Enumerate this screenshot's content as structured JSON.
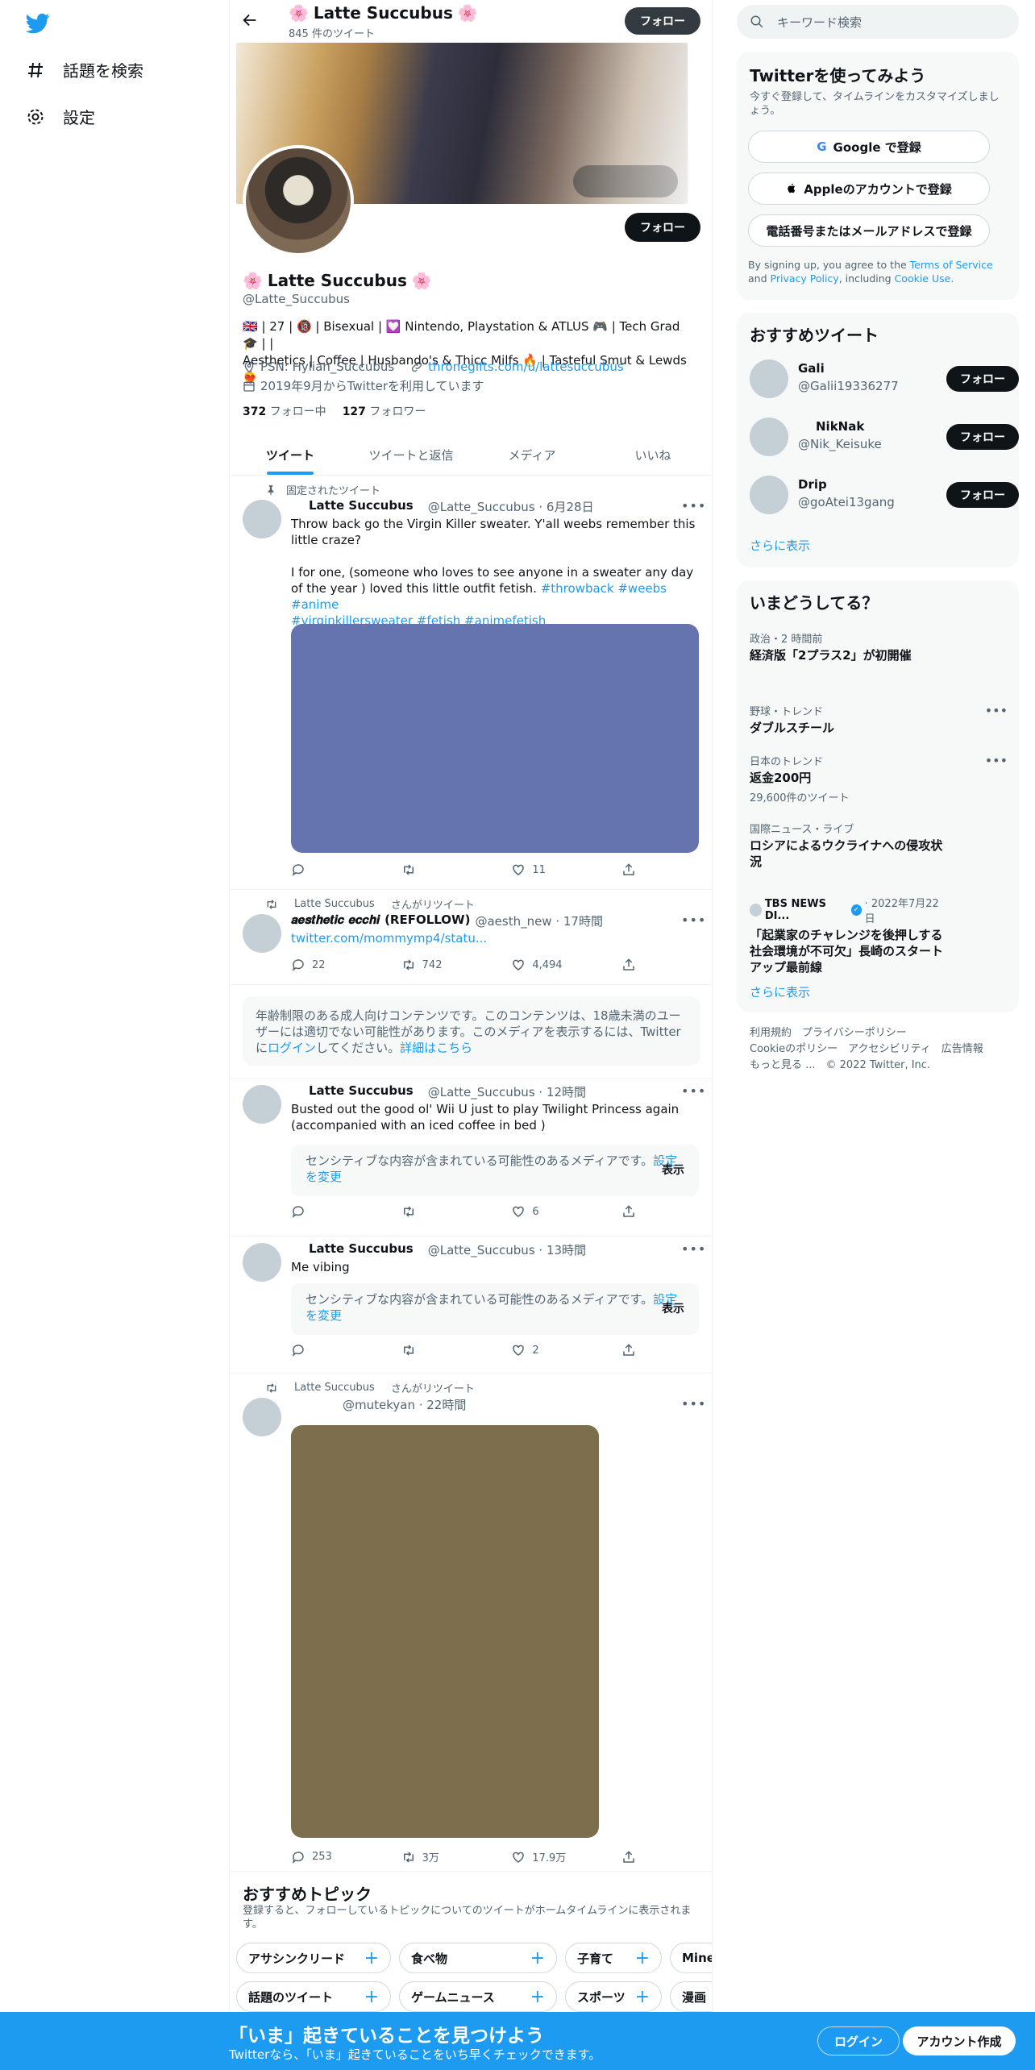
{
  "nav": {
    "explore_label": "話題を検索",
    "settings_label": "設定"
  },
  "header": {
    "title": "Latte Succubus",
    "tweet_count": "845 件のツイート",
    "follow_label": "フォロー"
  },
  "profile": {
    "name": "Latte Succubus",
    "handle": "@Latte_Succubus",
    "bio_line1": "🇬🇧 | 27 | 🔞 | Bisexual | 💟 Nintendo, Playstation & ATLUS 🎮 | Tech Grad 🎓 | |",
    "bio_line2": "Aesthetics | Coffee | Husbando's & Thicc Milfs 🔥 | Tasteful Smut & Lewds ❤️‍🔥",
    "location": "PSN: Hylian_Succubus",
    "link": "thronegifts.com/u/lattesuccubus",
    "joined": "2019年9月からTwitterを利用しています",
    "following_count": "372",
    "following_label": "フォロー中",
    "followers_count": "127",
    "followers_label": "フォロワー",
    "follow_label": "フォロー"
  },
  "tabs": [
    "ツイート",
    "ツイートと返信",
    "メディア",
    "いいね"
  ],
  "tweets": [
    {
      "context": "固定されたツイート",
      "name": "Latte Succubus",
      "meta": "@Latte_Succubus · 6月28日",
      "text1": "Throw back go the Virgin Killer sweater. Y'all weebs remember this little craze?",
      "text2": "I for one, (someone who loves to see anyone in a sweater any day of the year      ) loved this little outfit fetish.",
      "tags1": "#throwback #weebs #anime",
      "tags2": "#virginkillersweater #fetish #animefetish",
      "likes": "11"
    },
    {
      "context_name": "Latte Succubus",
      "context": "さんがリツイート",
      "name": "𝒂𝒆𝒔𝒕𝒉𝒆𝒕𝒊𝒄 𝒆𝒄𝒄𝒉𝒊",
      "name_suffix": "(REFOLLOW)",
      "meta": "@aesth_new · 17時間",
      "link": "twitter.com/mommymp4/statu...",
      "replies": "22",
      "retweets": "742",
      "likes": "4,494"
    },
    {
      "name": "Latte Succubus",
      "meta": "@Latte_Succubus · 12時間",
      "text1": "Busted out the good ol' Wii U just to play Twilight Princess again",
      "text2": "(accompanied with an iced coffee in bed           )",
      "likes": "6"
    },
    {
      "name": "Latte Succubus",
      "meta": "@Latte_Succubus · 13時間",
      "text1": "Me vibing",
      "likes": "2"
    },
    {
      "context_name": "Latte Succubus",
      "context": "さんがリツイート",
      "meta": "@mutekyan · 22時間",
      "replies": "253",
      "retweets": "3万",
      "likes": "17.9万"
    }
  ],
  "age_notice": {
    "text1": "年齢制限のある成人向けコンテンツです。このコンテンツは、18歳未満のユーザーには適切でない可能性があります。このメディアを表示するには、Twitter",
    "text2a": "に",
    "login": "ログイン",
    "text2b": "してください。",
    "more": "詳細はこちら"
  },
  "sensitive": {
    "text": "センシティブな内容が含まれている可能性のあるメディアです。",
    "link": "設定を変更",
    "show": "表示"
  },
  "topics": {
    "title": "おすすめトピック",
    "subtitle": "登録すると、フォローしているトピックについてのツイートがホームタイムラインに表示されます。",
    "row1": [
      "アサシンクリード",
      "食べ物",
      "子育て",
      "Mine"
    ],
    "row2": [
      "話題のツイート",
      "ゲームニュース",
      "スポーツ",
      "漫画"
    ]
  },
  "right": {
    "search_placeholder": "キーワード検索",
    "signup": {
      "title": "Twitterを使ってみよう",
      "subtitle": "今すぐ登録して、タイムラインをカスタマイズしましょう。",
      "google": "Google で登録",
      "apple": "Appleのアカウントで登録",
      "phone": "電話番号またはメールアドレスで登録",
      "terms_a": "By signing up, you agree to the",
      "terms_tos": "Terms of Service",
      "terms_and": "and",
      "terms_privacy": "Privacy Policy",
      "terms_inc": ", including",
      "terms_cookie": "Cookie Use."
    },
    "who": {
      "title": "おすすめツイート",
      "users": [
        {
          "name": "Gali",
          "handle": "@Galii19336277"
        },
        {
          "name": "NikNak",
          "handle": "@Nik_Keisuke"
        },
        {
          "name": "Drip",
          "handle": "@goAtei13gang"
        }
      ],
      "follow": "フォロー",
      "more": "さらに表示"
    },
    "trends": {
      "title": "いまどうしてる？",
      "items": [
        {
          "cat": "政治・2 時間前",
          "topic": "経済版「2プラス2」が初開催"
        },
        {
          "cat": "野球・トレンド",
          "topic": "ダブルスチール"
        },
        {
          "cat": "日本のトレンド",
          "topic": "返金200円",
          "count": "29,600件のツイート"
        },
        {
          "cat": "国際ニュース・ライブ",
          "topic": "ロシアによるウクライナへの侵攻状況"
        },
        {
          "source": "TBS NEWS DI...",
          "date": "· 2022年7月22日",
          "topic": "「起業家のチャレンジを後押しする社会環境が不可欠」長崎のスタートアップ最前線"
        }
      ],
      "more": "さらに表示"
    },
    "footer": {
      "line1": "利用規約　プライバシーポリシー",
      "line2": "Cookieのポリシー　アクセシビリティ　広告情報",
      "line3": "もっと見る ...　© 2022 Twitter, Inc."
    }
  },
  "bottom": {
    "headline": "「いま」起きていることを見つけよう",
    "sub": "Twitterなら、「いま」起きていることをいち早くチェックできます。",
    "login": "ログイン",
    "signup": "アカウント作成"
  },
  "colors": {
    "accent": "#1d9bf0",
    "media1": "#6573ae",
    "media2": "#7d6e4d"
  }
}
